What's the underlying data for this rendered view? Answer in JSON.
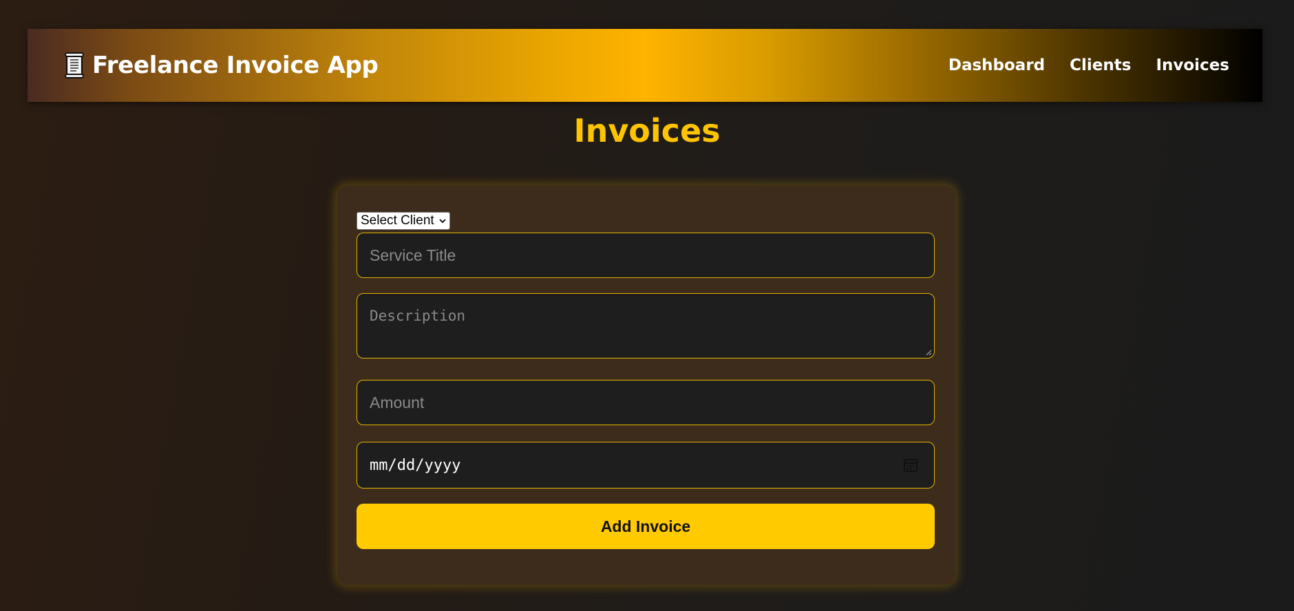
{
  "header": {
    "logo_icon": "scroll-icon",
    "title": "Freelance Invoice App",
    "nav": [
      {
        "label": "Dashboard"
      },
      {
        "label": "Clients"
      },
      {
        "label": "Invoices"
      }
    ]
  },
  "page": {
    "title": "Invoices"
  },
  "form": {
    "client_select": {
      "selected": "Select Client",
      "icon": "chevron-down-icon"
    },
    "service_title_placeholder": "Service Title",
    "description_placeholder": "Description",
    "amount_placeholder": "Amount",
    "date_placeholder": "mm/dd/yyyy",
    "date_icon": "calendar-icon",
    "submit_label": "Add Invoice"
  },
  "colors": {
    "accent": "#ffc400",
    "button": "#ffca00",
    "field_border": "#e6b400",
    "card_bg": "#3d2c1c"
  }
}
